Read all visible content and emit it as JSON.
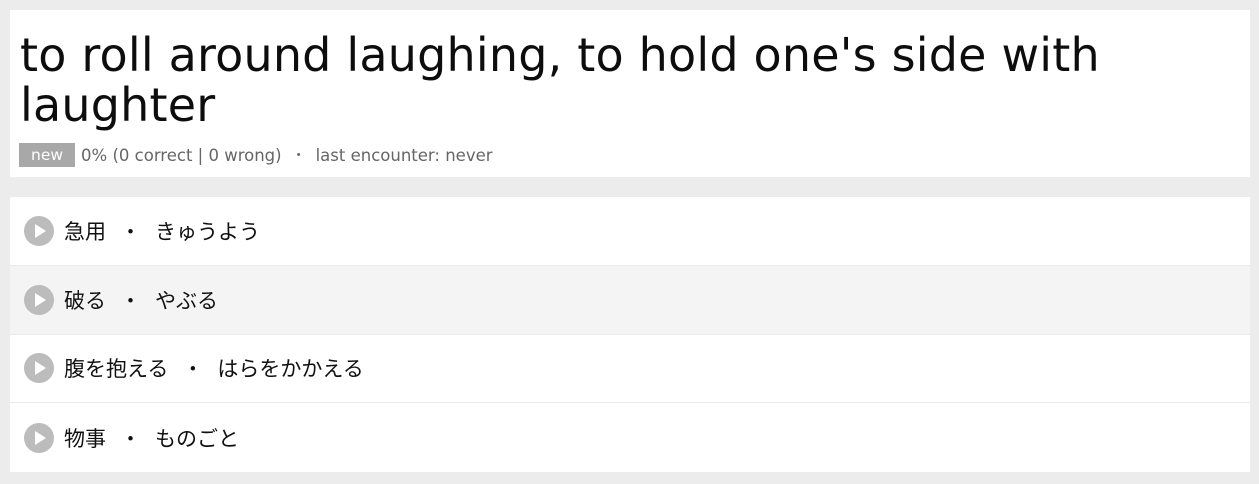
{
  "question": {
    "title": "to roll around laughing, to hold one's side with laughter",
    "badge": "new",
    "score": "0% (0 correct | 0 wrong)",
    "separator": "・",
    "last_encounter": "last encounter: never"
  },
  "answers": [
    {
      "word": "急用",
      "reading": "きゅうよう",
      "icon": "play-icon"
    },
    {
      "word": "破る",
      "reading": "やぶる",
      "icon": "play-icon"
    },
    {
      "word": "腹を抱える",
      "reading": "はらをかかえる",
      "icon": "play-icon"
    },
    {
      "word": "物事",
      "reading": "ものごと",
      "icon": "play-icon"
    }
  ],
  "answer_separator": "・"
}
